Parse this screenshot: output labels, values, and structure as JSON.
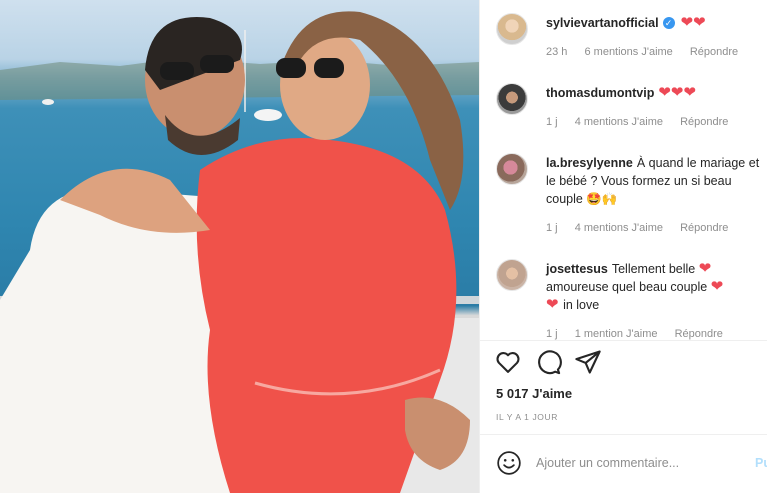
{
  "comments": [
    {
      "user": "sylvievartanofficial",
      "verified": true,
      "text": "",
      "hearts": "❤❤",
      "time": "23 h",
      "likes": "6 mentions J'aime",
      "reply": "Répondre"
    },
    {
      "user": "thomasdumontvip",
      "verified": false,
      "text": "",
      "hearts": "❤❤❤",
      "time": "1 j",
      "likes": "4 mentions J'aime",
      "reply": "Répondre"
    },
    {
      "user": "la.bresylyenne",
      "verified": false,
      "text": "À quand le mariage et le bébé ? Vous formez un si beau couple",
      "emoji": "🤩🙌",
      "time": "1 j",
      "likes": "4 mentions J'aime",
      "reply": "Répondre"
    },
    {
      "user": "josettesus",
      "verified": false,
      "text1": "Tellement belle",
      "text2": "amoureuse quel beau couple",
      "text3": "in love",
      "time": "1 j",
      "likes": "1 mention J'aime",
      "reply": "Répondre"
    }
  ],
  "likes_count": "5 017 J'aime",
  "post_age": "IL Y A 1 JOUR",
  "add_comment": {
    "placeholder": "Ajouter un commentaire...",
    "publish": "Pu"
  },
  "icons": [
    "heart-icon",
    "comment-icon",
    "share-icon",
    "emoji-icon"
  ]
}
